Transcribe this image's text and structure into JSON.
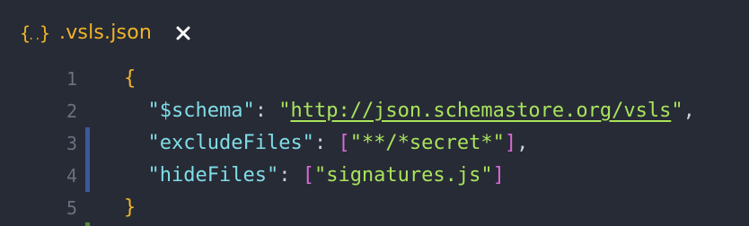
{
  "tab": {
    "icon": "json-braces-icon",
    "title": ".vsls.json",
    "close_icon": "close-icon"
  },
  "colors": {
    "background": "#272b36",
    "accent_yellow": "#f0b429",
    "key_cyan": "#7fdde7",
    "string_green": "#a9e35c",
    "bracket_magenta": "#d56bd6",
    "line_number": "#6a717f",
    "diff_marker": "#3b5a9a"
  },
  "lines": [
    {
      "num": "1",
      "open_brace": "{"
    },
    {
      "num": "2",
      "indent": "  ",
      "key": "\"$schema\"",
      "colon": ": ",
      "q1": "\"",
      "url": "http://json.schemastore.org/vsls",
      "q2": "\"",
      "comma": ","
    },
    {
      "num": "3",
      "indent": "  ",
      "key": "\"excludeFiles\"",
      "colon": ": ",
      "lb": "[",
      "value": "\"**/*secret*\"",
      "rb": "]",
      "comma": ","
    },
    {
      "num": "4",
      "indent": "  ",
      "key": "\"hideFiles\"",
      "colon": ": ",
      "lb": "[",
      "value": "\"signatures.js\"",
      "rb": "]"
    },
    {
      "num": "5",
      "close_brace": "}"
    }
  ]
}
